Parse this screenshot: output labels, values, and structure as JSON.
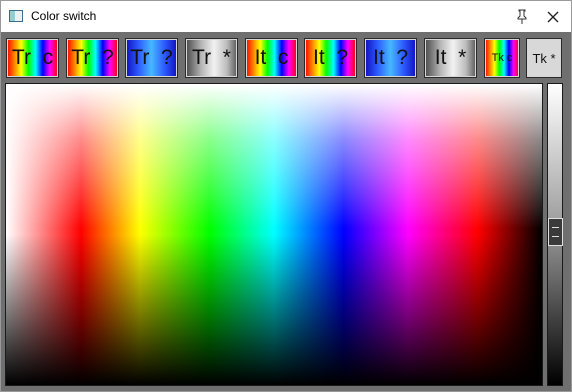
{
  "window": {
    "title": "Color switch"
  },
  "toolbar": {
    "buttons": [
      {
        "label": "Tr  c",
        "style": "rainbow"
      },
      {
        "label": "Tr  ?",
        "style": "rainbow"
      },
      {
        "label": "Tr  ?",
        "style": "blue"
      },
      {
        "label": "Tr  *",
        "style": "gray"
      },
      {
        "label": "It  c",
        "style": "rainbow"
      },
      {
        "label": "It  ?",
        "style": "rainbow"
      },
      {
        "label": "It  ?",
        "style": "blue"
      },
      {
        "label": "It  *",
        "style": "gray"
      },
      {
        "label": "Tk c",
        "style": "rainbow"
      },
      {
        "label": "Tk *",
        "style": "plain"
      }
    ]
  },
  "color_picker": {
    "hue_colors": [
      "#ffffff",
      "#ff0000",
      "#ffff00",
      "#00ff00",
      "#00ffff",
      "#0000ff",
      "#ff00ff",
      "#ff0000",
      "#000000"
    ]
  },
  "brightness_slider": {
    "level": 0.5
  },
  "icons": {
    "app": "window-icon",
    "pin": "pin-icon",
    "close": "close-icon"
  }
}
